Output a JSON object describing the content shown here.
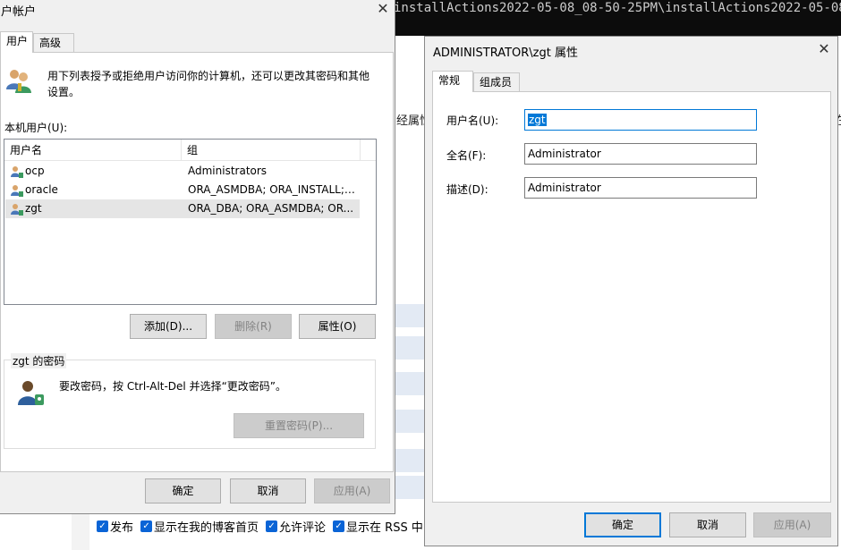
{
  "background": {
    "terminal_text": "installActions2022-05-08_08-50-25PM\\installActions2022-05-08_08",
    "page_text_left": "经属性",
    "page_text_right": "在",
    "checkboxes": [
      {
        "label": "发布",
        "checked": true
      },
      {
        "label": "显示在我的博客首页",
        "checked": true
      },
      {
        "label": "允许评论",
        "checked": true
      },
      {
        "label": "显示在 RSS 中",
        "checked": true
      },
      {
        "label": "",
        "checked": false
      }
    ]
  },
  "users_dialog": {
    "title": "户帐户",
    "close_icon": "close-icon",
    "tabs": [
      {
        "label": "用户",
        "active": true
      },
      {
        "label": "高级",
        "active": false
      }
    ],
    "intro_icon": "users-icon",
    "intro_text_line1": "用下列表授予或拒绝用户访问你的计算机，还可以更改其密码和其他",
    "intro_text_line2": "设置。",
    "users_label": "本机用户(U):",
    "columns": [
      "用户名",
      "组"
    ],
    "rows": [
      {
        "name": "ocp",
        "group": "Administrators",
        "icon": "user-icon",
        "selected": false
      },
      {
        "name": "oracle",
        "group": "ORA_ASMDBA; ORA_INSTALL; ...",
        "icon": "user-icon",
        "selected": false
      },
      {
        "name": "zgt",
        "group": "ORA_DBA; ORA_ASMDBA; OR...",
        "icon": "user-icon",
        "selected": true
      }
    ],
    "add_button": "添加(D)...",
    "remove_button": "删除(R)",
    "properties_button": "属性(O)",
    "password_group_title": "zgt 的密码",
    "password_icon": "user-key-icon",
    "password_text": "要改密码，按 Ctrl-Alt-Del 并选择“更改密码”。",
    "reset_password_button": "重置密码(P)...",
    "ok_button": "确定",
    "cancel_button": "取消",
    "apply_button": "应用(A)"
  },
  "properties_dialog": {
    "title": "ADMINISTRATOR\\zgt 属性",
    "close_icon": "close-icon",
    "tabs": [
      {
        "label": "常规",
        "active": true
      },
      {
        "label": "组成员",
        "active": false
      }
    ],
    "username_label": "用户名(U):",
    "username_value": "zgt",
    "fullname_label": "全名(F):",
    "fullname_value": "Administrator",
    "description_label": "描述(D):",
    "description_value": "Administrator",
    "ok_button": "确定",
    "cancel_button": "取消",
    "apply_button": "应用(A)"
  }
}
